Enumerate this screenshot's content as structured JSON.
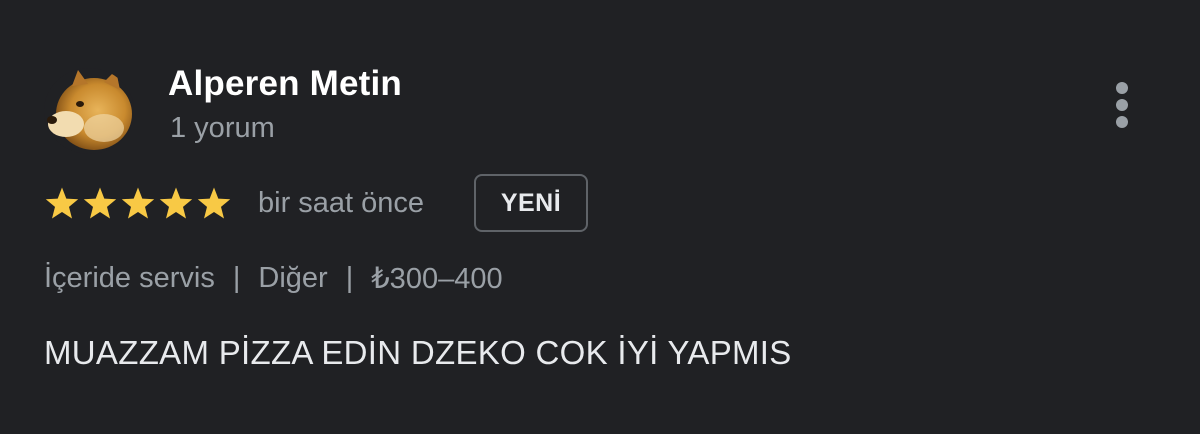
{
  "reviewer": {
    "name": "Alperen Metin",
    "meta": "1 yorum"
  },
  "rating": {
    "stars": 5,
    "max": 5,
    "color": "#f8c945"
  },
  "time": "bir saat önce",
  "badge": "YENİ",
  "details": {
    "service": "İçeride servis",
    "category": "Diğer",
    "price": "₺300–400",
    "separator": "|"
  },
  "review_text": "MUAZZAM PİZZA EDİN DZEKO COK İYİ YAPMIS",
  "icons": {
    "avatar": "avatar-dog-image",
    "more": "more-vert-icon",
    "star": "star-icon"
  }
}
